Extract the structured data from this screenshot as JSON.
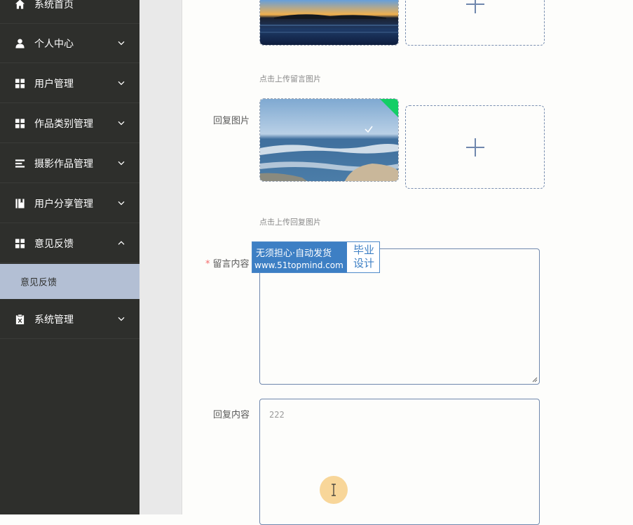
{
  "sidebar": {
    "items": [
      {
        "label": "系统首页",
        "icon": "home-icon"
      },
      {
        "label": "个人中心",
        "icon": "user-icon"
      },
      {
        "label": "用户管理",
        "icon": "grid-icon"
      },
      {
        "label": "作品类别管理",
        "icon": "grid-icon"
      },
      {
        "label": "摄影作品管理",
        "icon": "list-icon"
      },
      {
        "label": "用户分享管理",
        "icon": "book-icon"
      },
      {
        "label": "意见反馈",
        "icon": "grid-icon"
      },
      {
        "label": "系统管理",
        "icon": "clipboard-icon"
      }
    ],
    "active_sub_item": "意见反馈"
  },
  "form": {
    "message_image_hint": "点击上传留言图片",
    "reply_image_label": "回复图片",
    "reply_image_hint": "点击上传回复图片",
    "message_content_label": "留言内容",
    "message_content_required": "*",
    "message_content_value": "",
    "reply_content_label": "回复内容",
    "reply_content_value": "222"
  },
  "watermark": {
    "line1": "无须担心·自动发货",
    "line2": "www.51topmind.com",
    "badge_top": "毕业",
    "badge_bottom": "设计"
  },
  "colors": {
    "sidebar_bg": "#2e2f2c",
    "active_sub_bg": "#b3bfd4",
    "accent": "#6f87ad",
    "required": "#f56c6c"
  }
}
